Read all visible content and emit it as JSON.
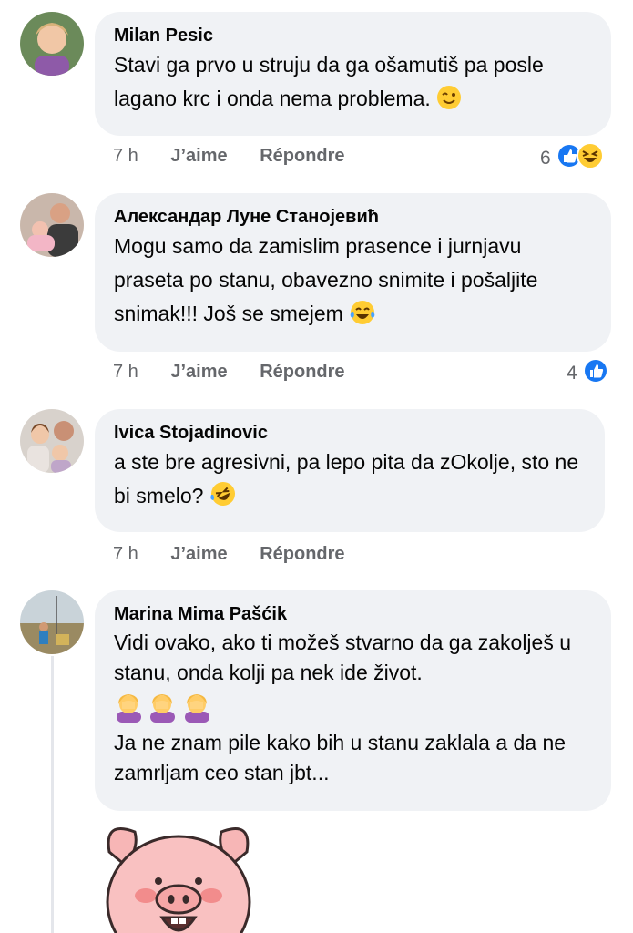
{
  "comments": [
    {
      "author": "Milan Pesic",
      "text": "Stavi ga prvo u struju da ga ošamutiš pa posle lagano krc i onda nema problema.",
      "time": "7 h",
      "like_label": "J’aime",
      "reply_label": "Répondre",
      "reaction_count": "6",
      "reactions": [
        "like",
        "haha"
      ]
    },
    {
      "author": "Александар Луне Станојевић",
      "text": "Mogu samo da zamislim prasence i jurnjavu praseta po stanu, obavezno snimite i pošaljite snimak!!! Još se smejem",
      "time": "7 h",
      "like_label": "J’aime",
      "reply_label": "Répondre",
      "reaction_count": "4",
      "reactions": [
        "like"
      ]
    },
    {
      "author": "Ivica Stojadinovic",
      "text": "a ste bre agresivni, pa lepo pita da zOkolje, sto ne bi smelo?",
      "time": "7 h",
      "like_label": "J’aime",
      "reply_label": "Répondre"
    },
    {
      "author": "Marina Mima Pašćik",
      "text_p1": "Vidi ovako, ako ti možeš stvarno da ga zakolješ u stanu, onda kolji pa nek ide život.",
      "text_p2": "Ja ne znam pile kako bih u stanu zaklala a da ne zamrljam ceo stan jbt..."
    }
  ],
  "icons": {
    "like": "like-reaction-icon",
    "haha": "haha-reaction-icon",
    "wink": "wink-emoji",
    "laugh": "tears-of-joy-emoji",
    "rofl": "rolling-laughing-emoji",
    "facepalm": "woman-facepalming-emoji",
    "sticker": "pig-sticker"
  },
  "colors": {
    "bubble": "#f0f2f5",
    "meta": "#65676b",
    "like_blue": "#1877f2"
  }
}
